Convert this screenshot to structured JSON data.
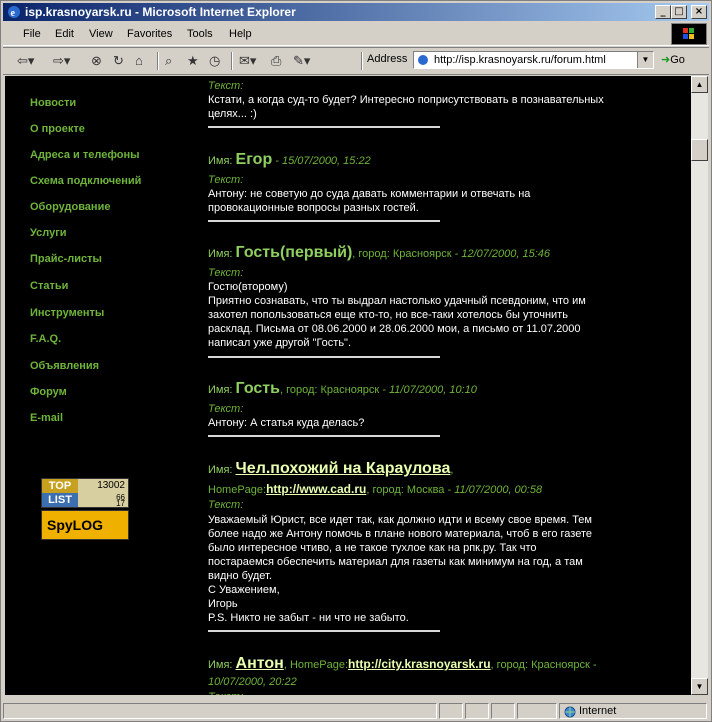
{
  "window": {
    "title": "isp.krasnoyarsk.ru - Microsoft Internet Explorer",
    "controls": {
      "minimize": "_",
      "maximize": "□",
      "close": "×"
    }
  },
  "menu": [
    "File",
    "Edit",
    "View",
    "Favorites",
    "Tools",
    "Help"
  ],
  "address": {
    "label": "Address",
    "url": "http://isp.krasnoyarsk.ru/forum.html",
    "go_label": "Go"
  },
  "nav": [
    "Новости",
    "О проекте",
    "Адреса и телефоны",
    "Схема подключений",
    "Оборудование",
    "Услуги",
    "Прайс-листы",
    "Статьи",
    "Инструменты",
    "F.A.Q.",
    "Объявления",
    "Форум",
    "E-mail"
  ],
  "counters": {
    "toplist": {
      "top": "TOP",
      "list": "LIST",
      "c1": "13002",
      "c2": "66",
      "c3": "17"
    },
    "spylog": "SpyLOG"
  },
  "labels": {
    "name": "Имя:",
    "text": "Текст:",
    "city": "город:",
    "homepage": "HomePage:"
  },
  "posts": [
    {
      "tail_text_label": "Текст:",
      "lines": [
        "Кстати, а когда суд-то будет? Интересно поприсутствовать в познавательных",
        "целях... :)"
      ]
    },
    {
      "name": "Егор",
      "meta": " - 15/07/2000, 15:22",
      "lines": [
        "Антону: не советую до суда давать комментарии и отвечать на",
        "провокационные вопросы разных гостей."
      ]
    },
    {
      "name": "Гость(первый)",
      "city": "Красноярск",
      "meta": " - 12/07/2000, 15:46",
      "lines": [
        "Гостю(второму)",
        "Приятно сознавать, что ты выдрал настолько удачный псевдоним, что им",
        "захотел попользоваться еще кто-то, но все-таки хотелось бы уточнить",
        "расклад. Письма от 08.06.2000 и 28.06.2000 мои, а письмо от 11.07.2000",
        "написал уже другой \"Гость\"."
      ]
    },
    {
      "name": "Гость",
      "city": "Красноярск",
      "meta": " - 11/07/2000, 10:10",
      "lines": [
        "Антону: А статья куда делась?"
      ]
    },
    {
      "name": "Чел.похожий на Караулова",
      "homepage": "http://www.cad.ru",
      "city": "Москва",
      "meta": " - 11/07/2000, 00:58",
      "lines": [
        "Уважаемый Юрист, все идет так, как должно идти и всему свое время. Тем",
        "более надо же Антону помочь в плане нового материала, чтоб в его газете",
        "было интересное чтиво, а не такое тухлое как на рпк.ру. Так что",
        "постараемся обеспечить материал для газеты как минимум на год, а там",
        "видно будет.",
        "С Уважением,",
        "Игорь",
        "P.S. Никто не забыт - ни что не забыто."
      ]
    },
    {
      "name": "Антон",
      "homepage": "http://city.krasnoyarsk.ru",
      "city": "Красноярск -",
      "meta": "10/07/2000, 20:22"
    }
  ],
  "status": {
    "zone": "Internet"
  }
}
